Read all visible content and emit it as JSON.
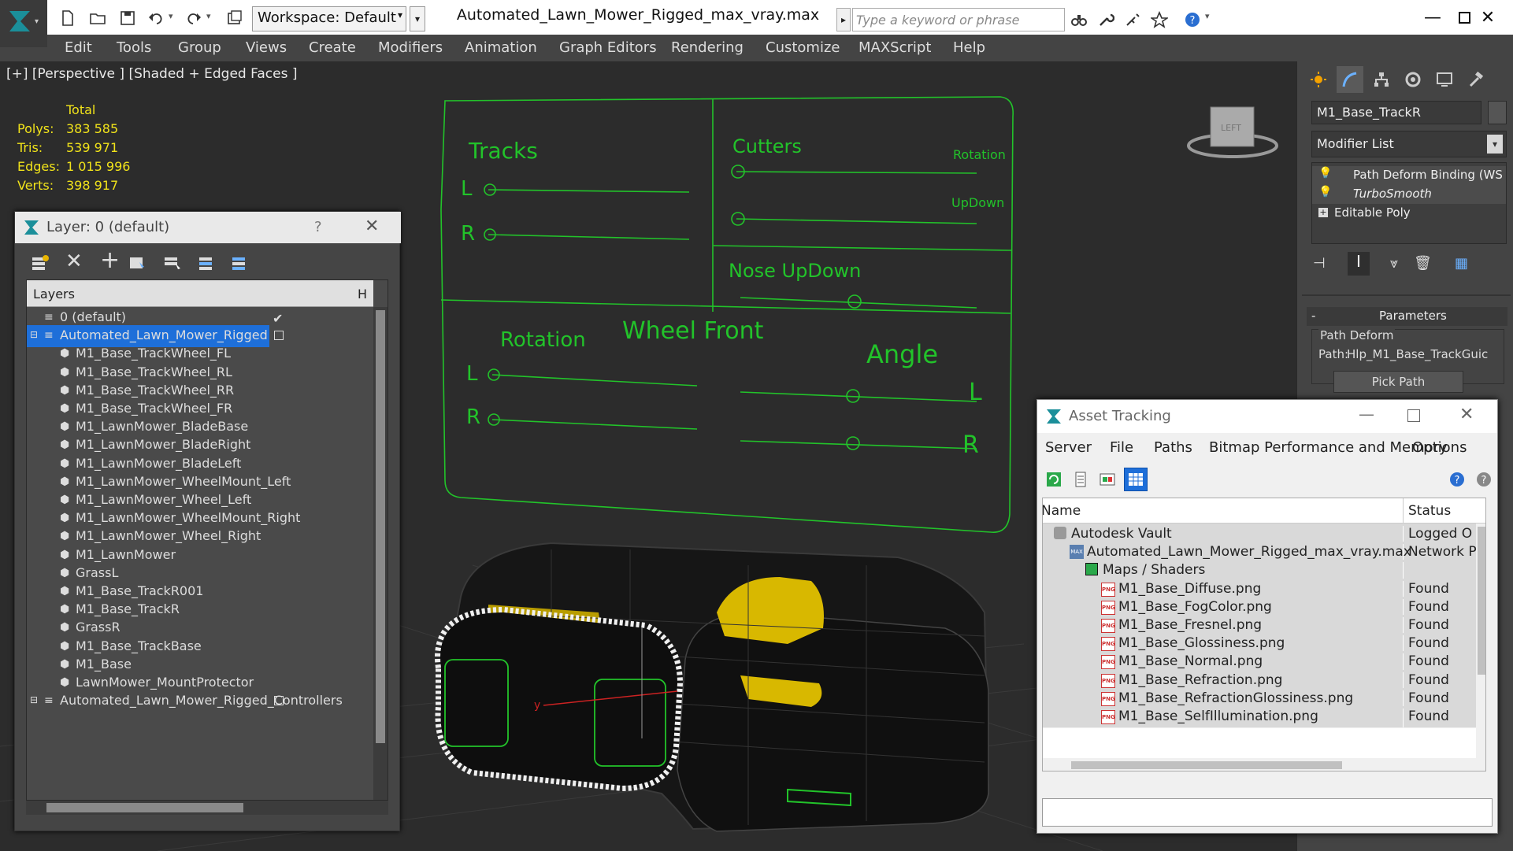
{
  "title_bar": {
    "workspace_label": "Workspace: Default",
    "file_title": "Automated_Lawn_Mower_Rigged_max_vray.max",
    "search_placeholder": "Type a keyword or phrase"
  },
  "menu": {
    "items": [
      "Edit",
      "Tools",
      "Group",
      "Views",
      "Create",
      "Modifiers",
      "Animation",
      "Graph Editors",
      "Rendering",
      "Customize",
      "MAXScript",
      "Help"
    ]
  },
  "viewport": {
    "label": "[+] [Perspective ] [Shaded + Edged Faces ]",
    "stats": {
      "total_label": "Total",
      "polys_label": "Polys:",
      "polys": "383 585",
      "tris_label": "Tris:",
      "tris": "539 971",
      "edges_label": "Edges:",
      "edges": "1 015 996",
      "verts_label": "Verts:",
      "verts": "398 917"
    },
    "controller_panel": {
      "tracks": "Tracks",
      "cutters": "Cutters",
      "rotation": "Rotation",
      "updown": "UpDown",
      "nose_updown": "Nose UpDown",
      "wheel_front": "Wheel Front",
      "wheel_rotation": "Rotation",
      "angle": "Angle",
      "l": "L",
      "r": "R"
    },
    "viewcube_label": "LEFT"
  },
  "layer_dialog": {
    "title": "Layer: 0 (default)",
    "help": "?",
    "column_layers": "Layers",
    "column_h": "H",
    "rows": [
      {
        "name": "0 (default)",
        "level": 0,
        "selected": false,
        "checked": true
      },
      {
        "name": "Automated_Lawn_Mower_Rigged",
        "level": 0,
        "selected": true,
        "checked": false
      },
      {
        "name": "M1_Base_TrackWheel_FL",
        "level": 1
      },
      {
        "name": "M1_Base_TrackWheel_RL",
        "level": 1
      },
      {
        "name": "M1_Base_TrackWheel_RR",
        "level": 1
      },
      {
        "name": "M1_Base_TrackWheel_FR",
        "level": 1
      },
      {
        "name": "M1_LawnMower_BladeBase",
        "level": 1
      },
      {
        "name": "M1_LawnMower_BladeRight",
        "level": 1
      },
      {
        "name": "M1_LawnMower_BladeLeft",
        "level": 1
      },
      {
        "name": "M1_LawnMower_WheelMount_Left",
        "level": 1
      },
      {
        "name": "M1_LawnMower_Wheel_Left",
        "level": 1
      },
      {
        "name": "M1_LawnMower_WheelMount_Right",
        "level": 1
      },
      {
        "name": "M1_LawnMower_Wheel_Right",
        "level": 1
      },
      {
        "name": "M1_LawnMower",
        "level": 1
      },
      {
        "name": "GrassL",
        "level": 1
      },
      {
        "name": "M1_Base_TrackR001",
        "level": 1
      },
      {
        "name": "M1_Base_TrackR",
        "level": 1
      },
      {
        "name": "GrassR",
        "level": 1
      },
      {
        "name": "M1_Base_TrackBase",
        "level": 1
      },
      {
        "name": "M1_Base",
        "level": 1
      },
      {
        "name": "LawnMower_MountProtector",
        "level": 1
      },
      {
        "name": "Automated_Lawn_Mower_Rigged_Controllers",
        "level": 0
      }
    ]
  },
  "command_panel": {
    "object_name": "M1_Base_TrackR",
    "modifier_list": "Modifier List",
    "stack": [
      "Path Deform Binding (WS",
      "TurboSmooth",
      "Editable Poly"
    ],
    "parameters_title": "Parameters",
    "group_label": "Path Deform",
    "path_label": "Path:",
    "path_value": "Hlp_M1_Base_TrackGuic",
    "pick_path": "Pick Path"
  },
  "asset_tracking": {
    "title": "Asset Tracking",
    "menu": [
      "Server",
      "File",
      "Paths",
      "Bitmap Performance and Memory",
      "Options"
    ],
    "col_name": "Name",
    "col_status": "Status",
    "rows": [
      {
        "name": "Autodesk Vault",
        "status": "Logged O",
        "level": 0,
        "icon": "vault"
      },
      {
        "name": "Automated_Lawn_Mower_Rigged_max_vray.max",
        "status": "Network P",
        "level": 1,
        "icon": "max"
      },
      {
        "name": "Maps / Shaders",
        "status": "",
        "level": 2,
        "icon": "maps"
      },
      {
        "name": "M1_Base_Diffuse.png",
        "status": "Found",
        "level": 3,
        "icon": "png"
      },
      {
        "name": "M1_Base_FogColor.png",
        "status": "Found",
        "level": 3,
        "icon": "png"
      },
      {
        "name": "M1_Base_Fresnel.png",
        "status": "Found",
        "level": 3,
        "icon": "png"
      },
      {
        "name": "M1_Base_Glossiness.png",
        "status": "Found",
        "level": 3,
        "icon": "png"
      },
      {
        "name": "M1_Base_Normal.png",
        "status": "Found",
        "level": 3,
        "icon": "png"
      },
      {
        "name": "M1_Base_Refraction.png",
        "status": "Found",
        "level": 3,
        "icon": "png"
      },
      {
        "name": "M1_Base_RefractionGlossiness.png",
        "status": "Found",
        "level": 3,
        "icon": "png"
      },
      {
        "name": "M1_Base_SelfIllumination.png",
        "status": "Found",
        "level": 3,
        "icon": "png"
      }
    ]
  },
  "colors": {
    "wire_green": "#22c32a",
    "stats_yellow": "#f1e31a",
    "selection_blue": "#1e6fd9",
    "model_yellow": "#d8b800"
  }
}
